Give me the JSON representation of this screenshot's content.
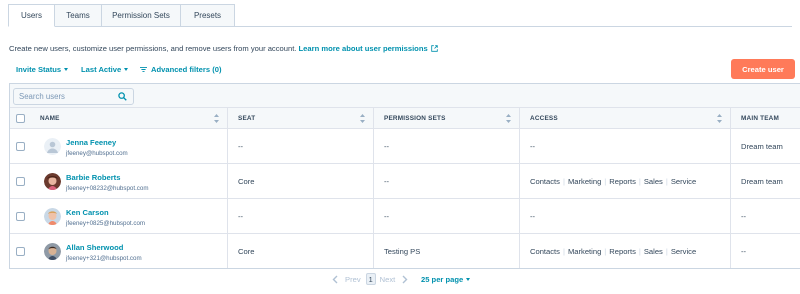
{
  "tabs": [
    {
      "label": "Users",
      "active": true
    },
    {
      "label": "Teams",
      "active": false
    },
    {
      "label": "Permission Sets",
      "active": false
    },
    {
      "label": "Presets",
      "active": false
    }
  ],
  "description": {
    "text": "Create new users, customize user permissions, and remove users from your account.",
    "link": "Learn more about user permissions"
  },
  "filters": {
    "invite_status": "Invite Status",
    "last_active": "Last Active",
    "advanced": "Advanced filters (0)"
  },
  "create_button": "Create user",
  "search": {
    "placeholder": "Search users",
    "value": ""
  },
  "columns": [
    "NAME",
    "SEAT",
    "PERMISSION SETS",
    "ACCESS",
    "MAIN TEAM"
  ],
  "rows": [
    {
      "name": "Jenna Feeney",
      "email": "jfeeney@hubspot.com",
      "seat": "--",
      "permission_sets": "--",
      "access": [
        "--"
      ],
      "main_team": "Dream team",
      "avatar": "default"
    },
    {
      "name": "Barbie Roberts",
      "email": "jfeeney+08232@hubspot.com",
      "seat": "Core",
      "permission_sets": "--",
      "access": [
        "Contacts",
        "Marketing",
        "Reports",
        "Sales",
        "Service"
      ],
      "main_team": "Dream team",
      "avatar": "photo-barbie"
    },
    {
      "name": "Ken Carson",
      "email": "jfeeney+0825@hubspot.com",
      "seat": "--",
      "permission_sets": "--",
      "access": [
        "--"
      ],
      "main_team": "--",
      "avatar": "photo-ken"
    },
    {
      "name": "Allan Sherwood",
      "email": "jfeeney+321@hubspot.com",
      "seat": "Core",
      "permission_sets": "Testing PS",
      "access": [
        "Contacts",
        "Marketing",
        "Reports",
        "Sales",
        "Service"
      ],
      "main_team": "--",
      "avatar": "photo-allan"
    }
  ],
  "pagination": {
    "prev": "Prev",
    "current": "1",
    "next": "Next",
    "per_page": "25 per page"
  },
  "colors": {
    "accent": "#0091ae",
    "primary_button": "#ff7a59",
    "text": "#33475b",
    "border": "#cbd6e2"
  }
}
